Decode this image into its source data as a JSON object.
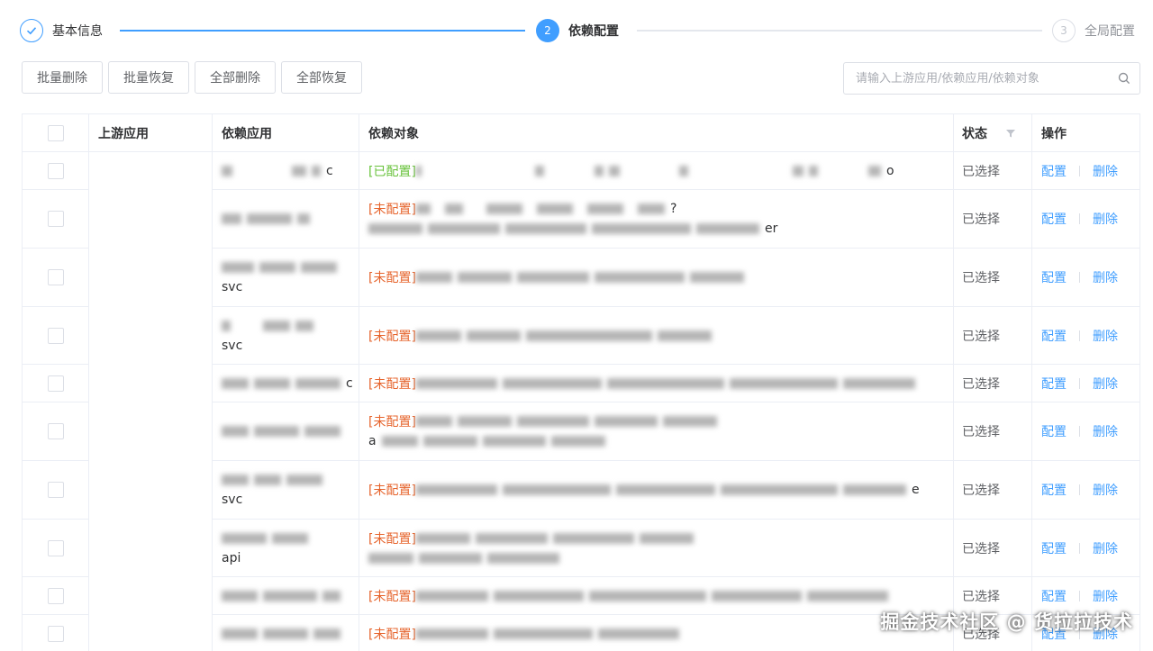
{
  "steps": [
    {
      "label": "基本信息",
      "index": "✓",
      "state": "done"
    },
    {
      "label": "依赖配置",
      "index": "2",
      "state": "active"
    },
    {
      "label": "全局配置",
      "index": "3",
      "state": "pending"
    }
  ],
  "toolbar": {
    "batch_delete": "批量删除",
    "batch_restore": "批量恢复",
    "delete_all": "全部删除",
    "restore_all": "全部恢复"
  },
  "search": {
    "placeholder": "请输入上游应用/依赖应用/依赖对象"
  },
  "table": {
    "headers": {
      "upstream": "上游应用",
      "dependency": "依赖应用",
      "object": "依赖对象",
      "status": "状态",
      "action": "操作"
    },
    "rows": [
      {
        "dep_suffix": "c",
        "tag": "[已配置]",
        "obj_suffix": "o",
        "obj_suffix2": "",
        "status": "已选择"
      },
      {
        "dep_suffix": "",
        "tag": "[未配置]",
        "obj_suffix": "?",
        "obj_suffix2": "er",
        "status": "已选择"
      },
      {
        "dep_suffix": "svc",
        "tag": "[未配置]",
        "obj_suffix": "",
        "obj_suffix2": "",
        "status": "已选择"
      },
      {
        "dep_suffix": "svc",
        "tag": "[未配置]",
        "obj_suffix": "",
        "obj_suffix2": "",
        "status": "已选择"
      },
      {
        "dep_suffix": "c",
        "tag": "[未配置]",
        "obj_suffix": "",
        "obj_suffix2": "",
        "status": "已选择"
      },
      {
        "dep_suffix": "",
        "tag": "[未配置]",
        "obj_suffix": "",
        "obj_suffix2": "a",
        "status": "已选择"
      },
      {
        "dep_suffix": "svc",
        "tag": "[未配置]",
        "obj_suffix": "e",
        "obj_suffix2": "",
        "status": "已选择"
      },
      {
        "dep_suffix": "api",
        "tag": "[未配置]",
        "obj_suffix": "",
        "obj_suffix2": "",
        "status": "已选择"
      },
      {
        "dep_suffix": "",
        "tag": "[未配置]",
        "obj_suffix": "",
        "obj_suffix2": "",
        "status": "已选择"
      },
      {
        "dep_suffix": "",
        "tag": "[未配置]",
        "obj_suffix": "",
        "obj_suffix2": "",
        "status": "已选择"
      }
    ],
    "op_config": "配置",
    "op_delete": "删除"
  },
  "watermark": "掘金技术社区 @ 货拉拉技术",
  "colors": {
    "primary": "#409eff",
    "configured": "#67c23a",
    "unconfigured": "#e6632b"
  }
}
